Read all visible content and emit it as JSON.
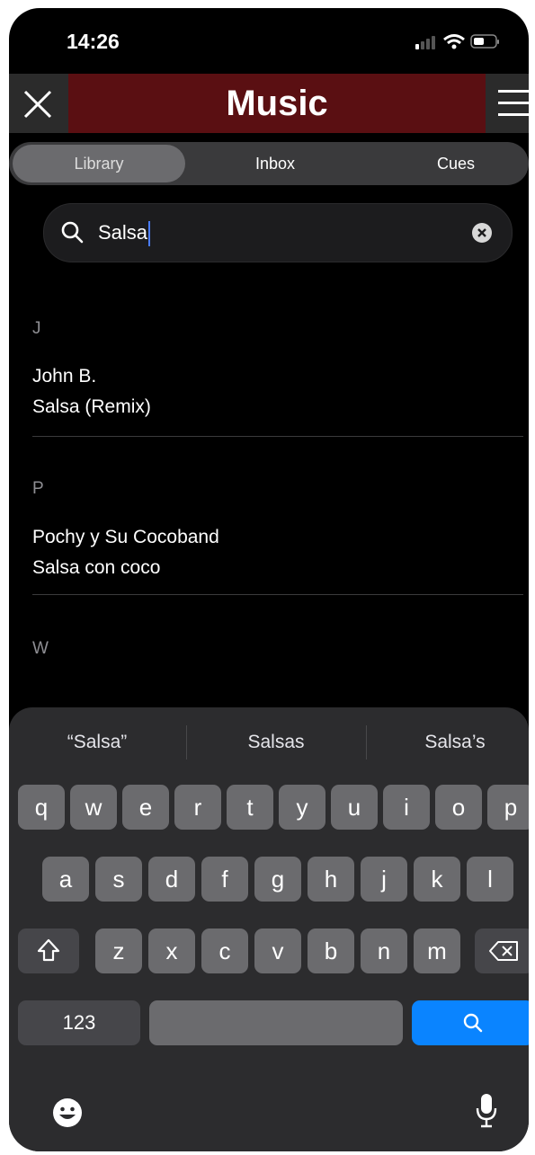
{
  "status": {
    "time": "14:26"
  },
  "nav": {
    "title": "Music"
  },
  "tabs": [
    "Library",
    "Inbox",
    "Cues"
  ],
  "search": {
    "value": "Salsa"
  },
  "sections": [
    {
      "letter": "J",
      "artist": "John B.",
      "title": "Salsa (Remix)"
    },
    {
      "letter": "P",
      "artist": "Pochy y Su Cocoband",
      "title": "Salsa con coco"
    },
    {
      "letter": "W"
    }
  ],
  "side_index": [
    "J",
    "P",
    "W"
  ],
  "keyboard": {
    "suggestions": [
      "“Salsa”",
      "Salsas",
      "Salsa’s"
    ],
    "row1": [
      "q",
      "w",
      "e",
      "r",
      "t",
      "y",
      "u",
      "i",
      "o",
      "p"
    ],
    "row2": [
      "a",
      "s",
      "d",
      "f",
      "g",
      "h",
      "j",
      "k",
      "l"
    ],
    "row3": [
      "z",
      "x",
      "c",
      "v",
      "b",
      "n",
      "m"
    ],
    "numbers_label": "123"
  },
  "colors": {
    "accent": "#0a84ff",
    "title_bar": "#5a0f12"
  }
}
